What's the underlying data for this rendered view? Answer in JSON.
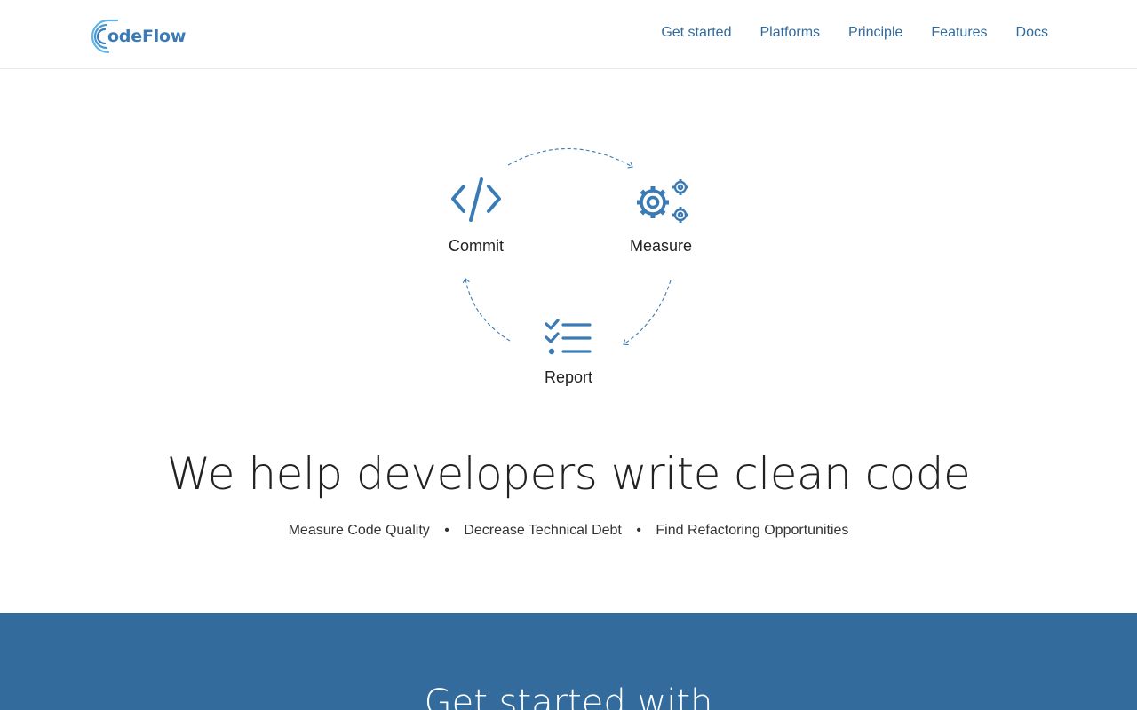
{
  "brand": {
    "name": "codeFlow",
    "logo_text": "odeFlow",
    "accent": "#3a7bb5",
    "light_accent": "#5eb5e6"
  },
  "nav": {
    "items": [
      {
        "label": "Get started"
      },
      {
        "label": "Platforms"
      },
      {
        "label": "Principle"
      },
      {
        "label": "Features"
      },
      {
        "label": "Docs"
      }
    ]
  },
  "cycle": {
    "steps": [
      {
        "label": "Commit",
        "icon": "code-icon"
      },
      {
        "label": "Measure",
        "icon": "gears-icon"
      },
      {
        "label": "Report",
        "icon": "checklist-icon"
      }
    ]
  },
  "hero": {
    "title": "We help developers write clean code",
    "bullets": [
      "Measure Code Quality",
      "Decrease Technical Debt",
      "Find Refactoring Opportunities"
    ],
    "separator": "•"
  },
  "band": {
    "title": "Get started with",
    "background": "#326b9c"
  }
}
